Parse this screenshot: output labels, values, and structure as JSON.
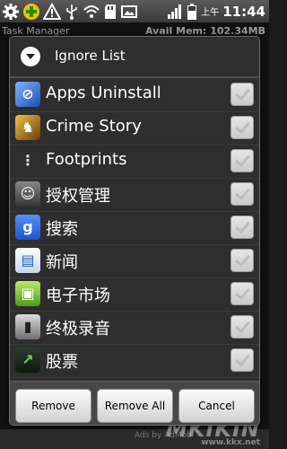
{
  "status_bar": {
    "icons": [
      "settings-icon",
      "add-icon",
      "warning-icon",
      "usb-icon",
      "wifi-icon",
      "sd-card-icon",
      "gallery-icon",
      "signal-icon",
      "battery-icon"
    ],
    "ampm": "上午",
    "time": "11:44"
  },
  "background_app": {
    "title": "Task Manager",
    "memory": "Avail Mem: 102.34MB",
    "footer": "Ads by AdMob"
  },
  "dialog": {
    "title": "Ignore List",
    "items": [
      {
        "label": "Apps Uninstall",
        "icon": "apps-uninstall-icon",
        "checked": true
      },
      {
        "label": "Crime Story",
        "icon": "crime-story-icon",
        "checked": true
      },
      {
        "label": "Footprints",
        "icon": "footprints-icon",
        "checked": true
      },
      {
        "label": "授权管理",
        "icon": "permission-manager-icon",
        "checked": true
      },
      {
        "label": "搜索",
        "icon": "google-search-icon",
        "checked": true
      },
      {
        "label": "新闻",
        "icon": "news-icon",
        "checked": true
      },
      {
        "label": "电子市场",
        "icon": "market-icon",
        "checked": true
      },
      {
        "label": "终极录音",
        "icon": "recorder-icon",
        "checked": true
      },
      {
        "label": "股票",
        "icon": "stocks-icon",
        "checked": true
      }
    ],
    "buttons": {
      "remove": "Remove",
      "remove_all": "Remove All",
      "cancel": "Cancel"
    }
  },
  "watermark": {
    "text": "MKIKIN",
    "url": "www.kkx.net"
  }
}
